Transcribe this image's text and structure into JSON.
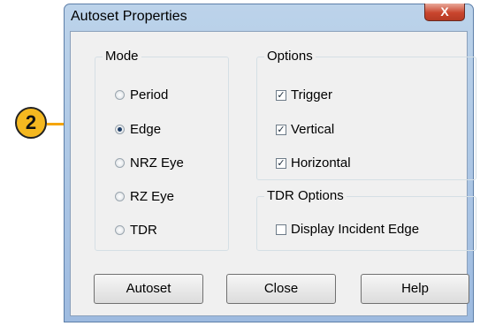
{
  "window": {
    "title": "Autoset Properties",
    "close_label": "X"
  },
  "mode": {
    "label": "Mode",
    "options": [
      {
        "label": "Period",
        "selected": false
      },
      {
        "label": "Edge",
        "selected": true
      },
      {
        "label": "NRZ Eye",
        "selected": false
      },
      {
        "label": "RZ Eye",
        "selected": false
      },
      {
        "label": "TDR",
        "selected": false
      }
    ]
  },
  "options": {
    "label": "Options",
    "items": [
      {
        "label": "Trigger",
        "checked": true
      },
      {
        "label": "Vertical",
        "checked": true
      },
      {
        "label": "Horizontal",
        "checked": true
      }
    ]
  },
  "tdr_options": {
    "label": "TDR Options",
    "items": [
      {
        "label": "Display Incident Edge",
        "checked": false
      }
    ]
  },
  "buttons": {
    "autoset": "Autoset",
    "close": "Close",
    "help": "Help"
  },
  "callout": {
    "number": "2",
    "color": "#f5b820"
  }
}
